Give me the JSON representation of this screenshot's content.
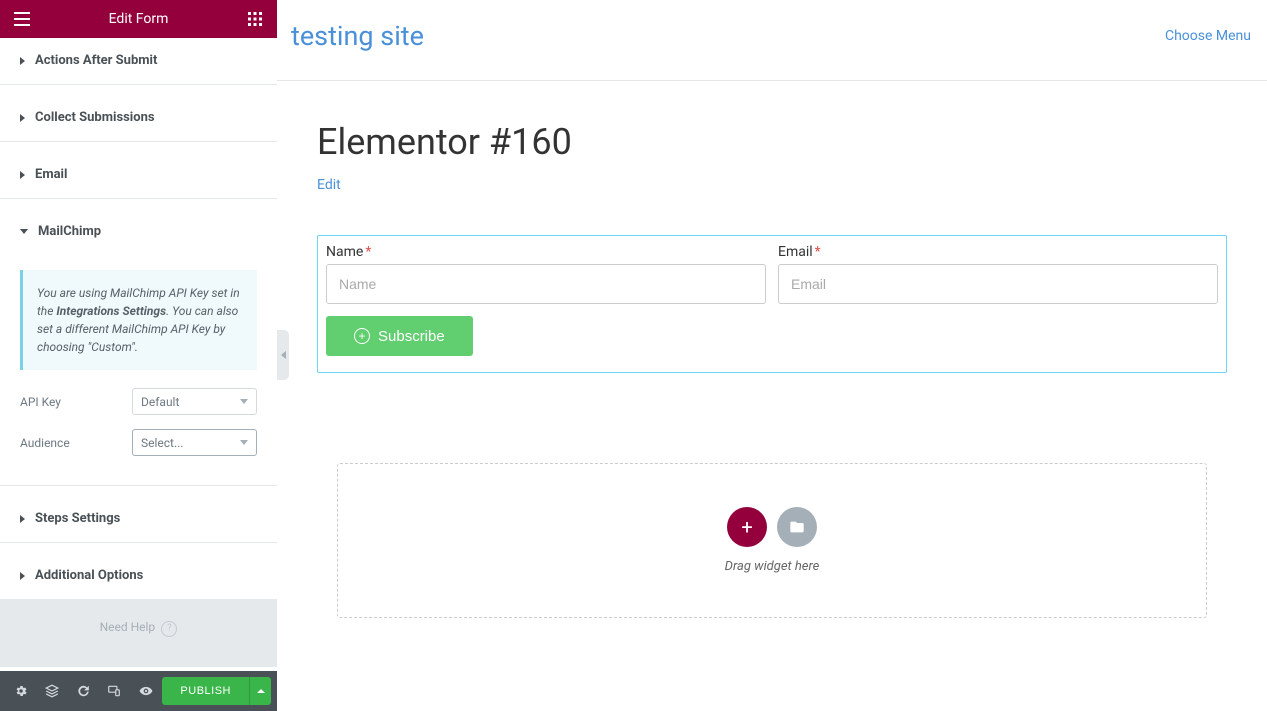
{
  "sidebar": {
    "title": "Edit Form",
    "sections": {
      "actions": "Actions After Submit",
      "collect": "Collect Submissions",
      "email": "Email",
      "mailchimp": "MailChimp",
      "steps": "Steps Settings",
      "additional": "Additional Options"
    },
    "mailchimp": {
      "info_pre": "You are using MailChimp API Key set in the ",
      "info_bold": "Integrations Settings",
      "info_post": ". You can also set a different MailChimp API Key by choosing \"Custom\".",
      "api_key_label": "API Key",
      "api_key_value": "Default",
      "audience_label": "Audience",
      "audience_value": "Select..."
    },
    "help": "Need Help",
    "publish": "PUBLISH"
  },
  "preview": {
    "site_title": "testing site",
    "choose_menu": "Choose Menu",
    "page_title": "Elementor #160",
    "edit": "Edit",
    "form": {
      "name_label": "Name",
      "name_placeholder": "Name",
      "email_label": "Email",
      "email_placeholder": "Email",
      "subscribe": "Subscribe"
    },
    "dropzone": "Drag widget here"
  }
}
